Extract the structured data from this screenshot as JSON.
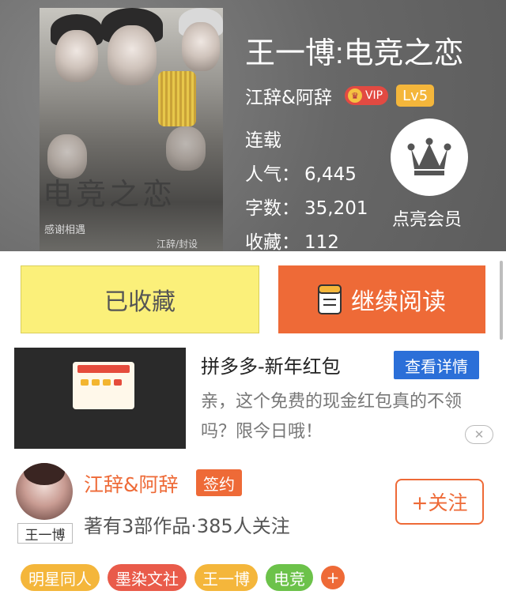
{
  "book": {
    "title": "王一博:电竞之恋",
    "cover_title": "电竞之恋",
    "cover_sub1": "感谢相遇",
    "cover_sub2": "江辞/封设",
    "author": "江辞&阿辞",
    "vip_label": "VIP",
    "level": "Lv5",
    "status": "连载",
    "stats": [
      {
        "label": "人气：",
        "value": "6,445"
      },
      {
        "label": "字数：",
        "value": "35,201"
      },
      {
        "label": "收藏：",
        "value": "112"
      }
    ],
    "member_label": "点亮会员"
  },
  "actions": {
    "favorited_label": "已收藏",
    "continue_label": "继续阅读"
  },
  "ad": {
    "title": "拼多多-新年红包",
    "detail_label": "查看详情",
    "desc": "亲，这个免费的现金红包真的不领吗？限今日哦！",
    "close_label": "✕"
  },
  "author_card": {
    "name": "江辞&阿辞",
    "badge": "签约",
    "avatar_tag": "王一博",
    "works": "著有3部作品·385人关注",
    "follow_label": "+关注"
  },
  "tags": [
    {
      "label": "明星同人",
      "color": "#f4b63b"
    },
    {
      "label": "墨染文社",
      "color": "#e95b4a"
    },
    {
      "label": "王一博",
      "color": "#f4b63b"
    },
    {
      "label": "电竞",
      "color": "#6cc24a"
    }
  ],
  "tag_add": "+",
  "colors": {
    "accent": "#ee6a37",
    "favorite_bg": "#fbf07a",
    "detail_blue": "#2b6fd8"
  }
}
